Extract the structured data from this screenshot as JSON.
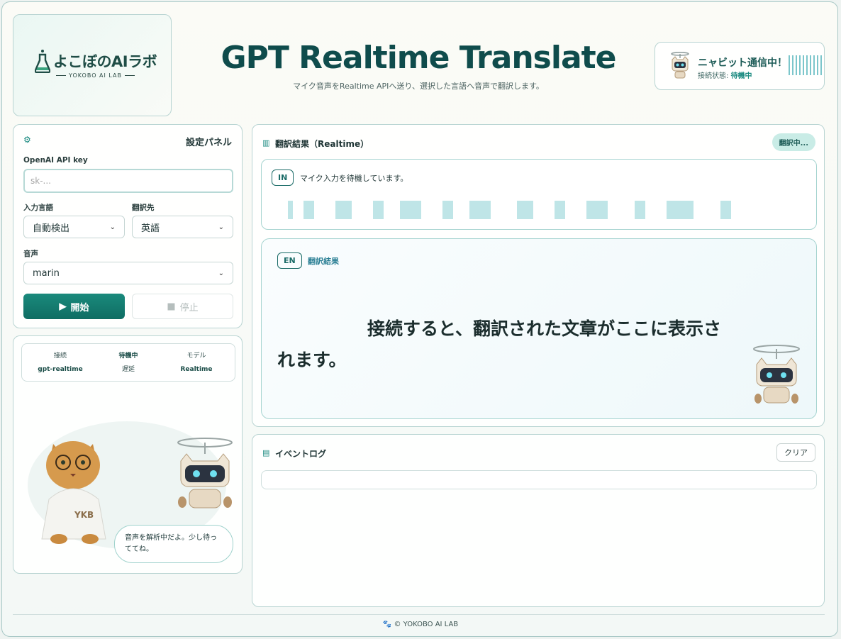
{
  "logo": {
    "text": "よこぼのAIラボ",
    "subtext": "YOKOBO AI LAB"
  },
  "header": {
    "title": "GPT Realtime Translate",
    "subtitle": "マイク音声をRealtime APIへ送り、選択した言語へ音声で翻訳します。"
  },
  "status": {
    "title": "ニャビット通信中！",
    "connection_label": "接続状態:",
    "connection_value": "待機中"
  },
  "settings": {
    "icon": "gear-icon",
    "title": "設定パネル",
    "api_key_label": "OpenAI API key",
    "api_key_placeholder": "sk-...",
    "input_lang_label": "入力言語",
    "input_lang_value": "自動検出",
    "target_lang_label": "翻訳先",
    "target_lang_value": "英語",
    "voice_label": "音声",
    "voice_value": "marin",
    "start_label": "開始",
    "stop_label": "停止"
  },
  "info": {
    "items": [
      {
        "label": "接続",
        "value": "gpt-realtime"
      },
      {
        "label": "待機中",
        "value": "遅延"
      },
      {
        "label": "モデル",
        "value": "Realtime"
      }
    ],
    "speech": "音声を解析中だよ。少し待っててね。"
  },
  "result": {
    "title": "翻訳結果（Realtime）",
    "badge": "翻訳中...",
    "in_tag": "IN",
    "in_text": "マイク入力を待機しています。",
    "out_tag": "EN",
    "out_label": "翻訳結果",
    "out_text": "接続すると、翻訳された文章がここに表示されます。"
  },
  "log": {
    "title": "イベントログ",
    "clear_label": "クリア"
  },
  "footer": {
    "text": "© YOKOBO AI LAB"
  },
  "colors": {
    "accent": "#0f6d63",
    "title": "#0f4c4c",
    "wave": "#bfe5e7"
  }
}
